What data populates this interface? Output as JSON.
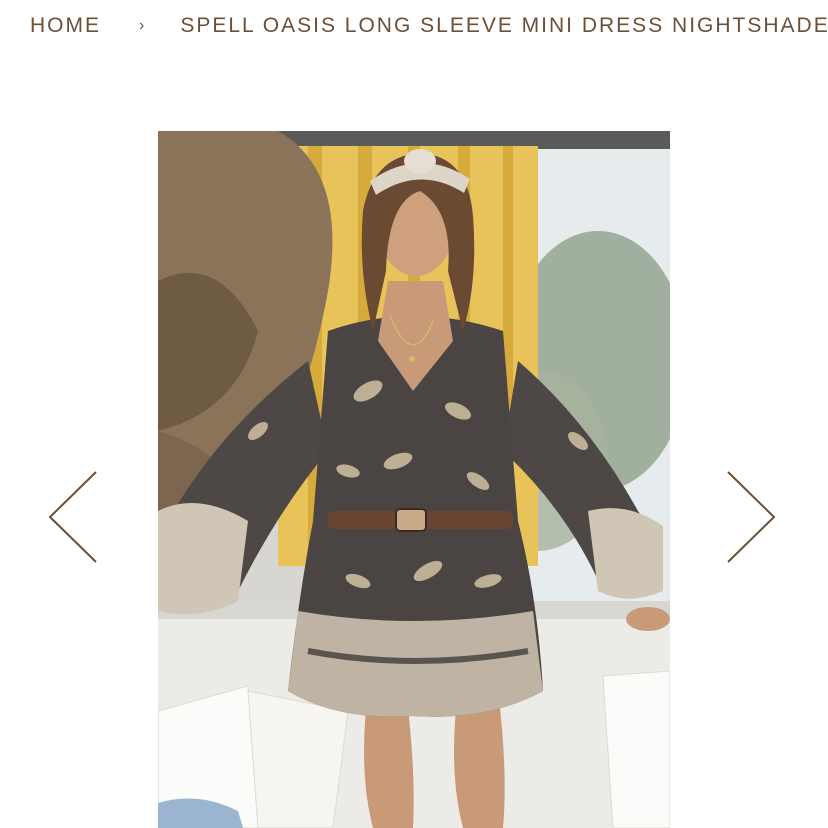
{
  "breadcrumb": {
    "home_label": "HOME",
    "separator": "›",
    "current": "SPELL OASIS LONG SLEEVE MINI DRESS NIGHTSHADE"
  },
  "gallery": {
    "prev_icon": "chevron-left-icon",
    "next_icon": "chevron-right-icon"
  },
  "colors": {
    "accent": "#6b4f36"
  }
}
